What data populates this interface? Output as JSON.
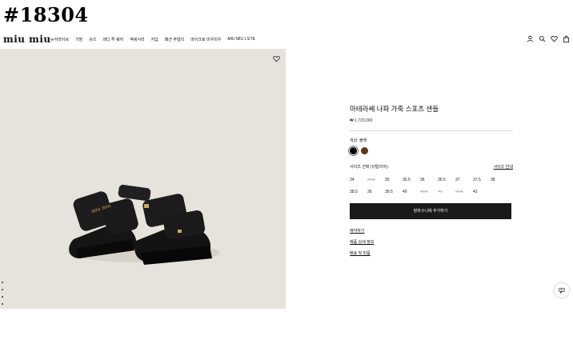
{
  "overlay_id": "#18304",
  "brand": {
    "logo": "miu miu"
  },
  "nav": {
    "menu": [
      "뉴어라이브",
      "가방",
      "슈즈",
      "레디 투 웨어",
      "액세서리",
      "지갑",
      "패션 주얼리",
      "마이크로 미우미우",
      "MIU MIU L'ETE"
    ],
    "icons": [
      "user-icon",
      "search-icon",
      "heart-icon",
      "bag-icon"
    ]
  },
  "product": {
    "title": "마테라쎄 나파 가죽 스포츠 샌들",
    "price": "₩ 1,720,000",
    "color_label": "색상: 블랙",
    "colors": [
      "#000000",
      "#5b3716"
    ],
    "size_label": "사이즈 선택 (이탈리아):",
    "size_guide": "사이즈 안내",
    "sizes": [
      {
        "label": "34",
        "available": true
      },
      {
        "label": "34.5",
        "available": false
      },
      {
        "label": "35",
        "available": true
      },
      {
        "label": "35.5",
        "available": true
      },
      {
        "label": "36",
        "available": true
      },
      {
        "label": "36.5",
        "available": true
      },
      {
        "label": "37",
        "available": true
      },
      {
        "label": "37.5",
        "available": true
      },
      {
        "label": "38",
        "available": true
      },
      {
        "label": "38.5",
        "available": true
      },
      {
        "label": "39",
        "available": true
      },
      {
        "label": "39.5",
        "available": true
      },
      {
        "label": "40",
        "available": true
      },
      {
        "label": "40.5",
        "available": false
      },
      {
        "label": "41",
        "available": false
      },
      {
        "label": "41.5",
        "available": false
      },
      {
        "label": "42",
        "available": true
      }
    ],
    "cart_button": "장바구니에 추가하기",
    "links": [
      "예약하기",
      "제품 상세 정보",
      "배송 및 반품"
    ]
  }
}
